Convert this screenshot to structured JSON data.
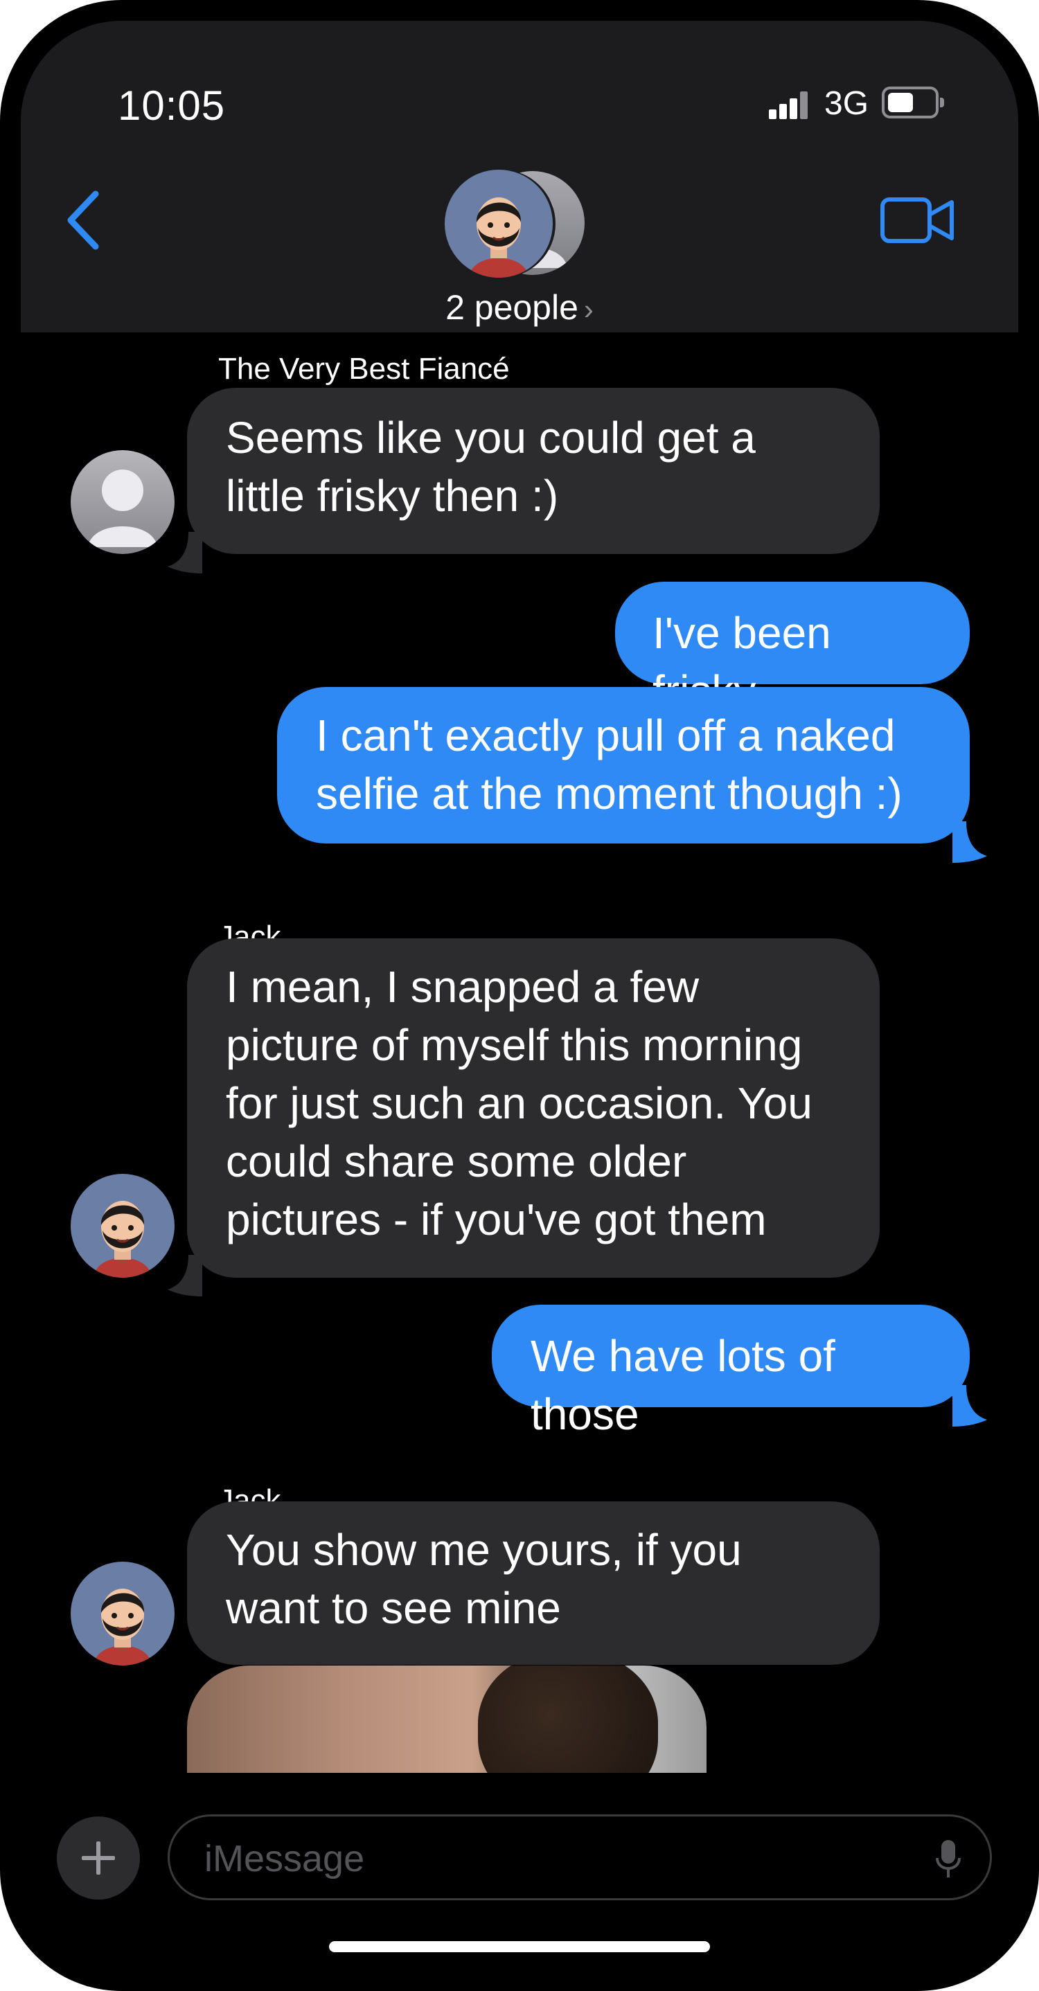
{
  "status_bar": {
    "time": "10:05",
    "network": "3G"
  },
  "header": {
    "participants_label": "2 people"
  },
  "messages": [
    {
      "sender": "The Very Best Fiancé",
      "direction": "incoming",
      "lines": [
        "Seems like you could get a",
        "little frisky then :)"
      ]
    },
    {
      "direction": "outgoing",
      "lines": [
        "I've been frisky"
      ]
    },
    {
      "direction": "outgoing",
      "lines": [
        "I can't exactly pull off a naked",
        "selfie at the moment though :)"
      ]
    },
    {
      "sender": "Jack",
      "direction": "incoming",
      "lines": [
        "I mean, I snapped a few",
        "picture of myself this morning",
        "for just such an occasion.  You",
        "could share some older",
        "pictures - if you've got them"
      ]
    },
    {
      "direction": "outgoing",
      "lines": [
        "We have lots of those"
      ]
    },
    {
      "sender": "Jack",
      "direction": "incoming",
      "lines": [
        "You show me yours, if you",
        "want to see mine"
      ]
    }
  ],
  "compose": {
    "placeholder": "iMessage"
  },
  "colors": {
    "outgoing_bubble": "#2f8af5",
    "incoming_bubble": "#2c2c2e",
    "accent": "#2f8af5"
  },
  "icons": [
    "back-chevron-icon",
    "video-camera-icon",
    "plus-icon",
    "microphone-icon",
    "signal-icon",
    "battery-icon"
  ]
}
